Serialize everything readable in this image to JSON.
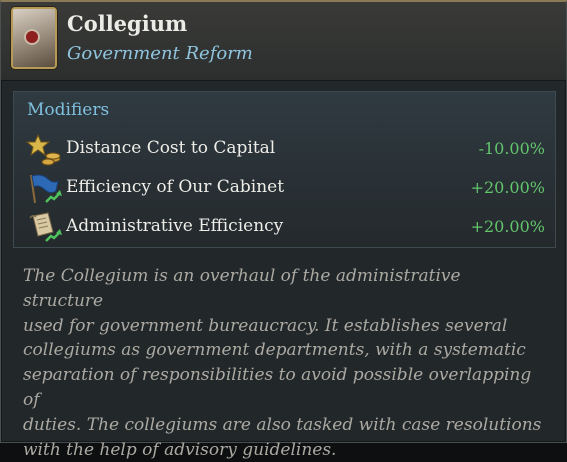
{
  "header": {
    "title": "Collegium",
    "subtitle": "Government Reform",
    "portrait_icon": "collegium-portrait-icon"
  },
  "modifiers": {
    "heading": "Modifiers",
    "items": [
      {
        "icon": "capital-distance-icon",
        "label": "Distance Cost to Capital",
        "value": "-10.00%"
      },
      {
        "icon": "cabinet-flag-icon",
        "label": "Efficiency of Our Cabinet",
        "value": "+20.00%"
      },
      {
        "icon": "administrative-scroll-icon",
        "label": "Administrative Efficiency",
        "value": "+20.00%"
      }
    ],
    "value_color": "#62c56c"
  },
  "description": {
    "lines": [
      "The Collegium is an overhaul of the administrative structure",
      "used for government bureaucracy. It establishes several",
      "collegiums as government departments, with a systematic",
      "separation of responsibilities to avoid possible overlapping of",
      "duties. The collegiums are also tasked with case resolutions",
      "with the help of advisory guidelines."
    ]
  }
}
